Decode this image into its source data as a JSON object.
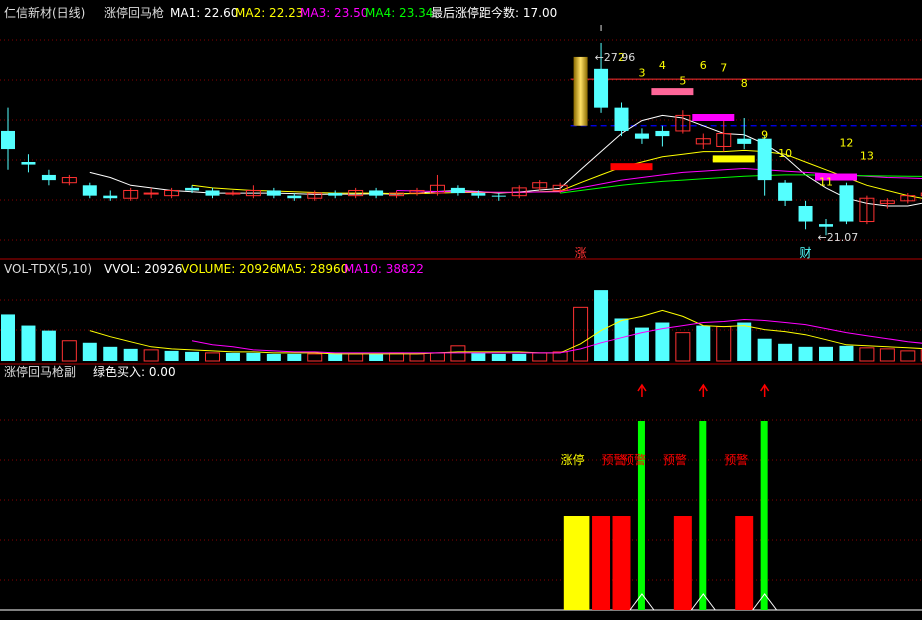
{
  "header_main": {
    "stock": "仁信新材(日线)",
    "indicator": "涨停回马枪",
    "ma1_label": "MA1: 22.60",
    "ma2_label": "MA2: 22.23",
    "ma3_label": "MA3: 23.50",
    "ma4_label": "MA4: 23.34",
    "last_limit_label": "最后涨停距今数: 17.00"
  },
  "header_vol": {
    "name": "VOL-TDX(5,10)",
    "vvol_label": "VVOL: 20926",
    "volume_label": "VOLUME: 20926",
    "ma5_label": "MA5: 28960",
    "ma10_label": "MA10: 38822"
  },
  "header_sub": {
    "name": "涨停回马枪副",
    "signal_label": "绿色买入: 0.00"
  },
  "colors": {
    "up": "#ff3232",
    "down": "#54ffff",
    "ma1": "#ffffff",
    "ma2": "#ffff00",
    "ma3": "#ff00ff",
    "ma4": "#00ff00",
    "grid": "#8b0000",
    "dash": "#0000ff",
    "vol_ma10": "#ff00ff",
    "vol_ma5": "#ffff00",
    "buy": "#00ff00",
    "warn": "#ff0000",
    "limit": "#ffff00"
  },
  "chart_data": [
    {
      "type": "candlestick",
      "panel": "price",
      "candles": [
        {
          "o": 24.4,
          "c": 25.1,
          "h": 26.0,
          "l": 23.6,
          "dir": "down"
        },
        {
          "o": 23.9,
          "c": 23.8,
          "h": 24.2,
          "l": 23.5,
          "dir": "down"
        },
        {
          "o": 23.4,
          "c": 23.2,
          "h": 23.6,
          "l": 23.0,
          "dir": "down"
        },
        {
          "o": 23.1,
          "c": 23.3,
          "h": 23.4,
          "l": 23.0,
          "dir": "up"
        },
        {
          "o": 23.0,
          "c": 22.6,
          "h": 23.1,
          "l": 22.5,
          "dir": "down"
        },
        {
          "o": 22.6,
          "c": 22.5,
          "h": 22.8,
          "l": 22.4,
          "dir": "down"
        },
        {
          "o": 22.5,
          "c": 22.8,
          "h": 22.9,
          "l": 22.4,
          "dir": "up"
        },
        {
          "o": 22.7,
          "c": 22.7,
          "h": 22.9,
          "l": 22.5,
          "dir": "up"
        },
        {
          "o": 22.6,
          "c": 22.8,
          "h": 22.9,
          "l": 22.5,
          "dir": "up"
        },
        {
          "o": 22.9,
          "c": 22.8,
          "h": 23.0,
          "l": 22.7,
          "dir": "down"
        },
        {
          "o": 22.8,
          "c": 22.6,
          "h": 22.9,
          "l": 22.5,
          "dir": "down"
        },
        {
          "o": 22.7,
          "c": 22.7,
          "h": 22.8,
          "l": 22.6,
          "dir": "up"
        },
        {
          "o": 22.6,
          "c": 22.8,
          "h": 23.0,
          "l": 22.5,
          "dir": "up"
        },
        {
          "o": 22.8,
          "c": 22.6,
          "h": 22.9,
          "l": 22.5,
          "dir": "down"
        },
        {
          "o": 22.6,
          "c": 22.5,
          "h": 22.7,
          "l": 22.4,
          "dir": "down"
        },
        {
          "o": 22.5,
          "c": 22.7,
          "h": 22.8,
          "l": 22.4,
          "dir": "up"
        },
        {
          "o": 22.7,
          "c": 22.6,
          "h": 22.8,
          "l": 22.5,
          "dir": "down"
        },
        {
          "o": 22.6,
          "c": 22.8,
          "h": 22.9,
          "l": 22.5,
          "dir": "up"
        },
        {
          "o": 22.8,
          "c": 22.6,
          "h": 22.9,
          "l": 22.5,
          "dir": "down"
        },
        {
          "o": 22.6,
          "c": 22.7,
          "h": 22.8,
          "l": 22.5,
          "dir": "up"
        },
        {
          "o": 22.7,
          "c": 22.8,
          "h": 22.9,
          "l": 22.6,
          "dir": "up"
        },
        {
          "o": 22.7,
          "c": 23.0,
          "h": 23.4,
          "l": 22.6,
          "dir": "up"
        },
        {
          "o": 22.9,
          "c": 22.7,
          "h": 23.0,
          "l": 22.6,
          "dir": "down"
        },
        {
          "o": 22.7,
          "c": 22.6,
          "h": 22.8,
          "l": 22.5,
          "dir": "down"
        },
        {
          "o": 22.6,
          "c": 22.6,
          "h": 22.7,
          "l": 22.4,
          "dir": "down"
        },
        {
          "o": 22.6,
          "c": 22.9,
          "h": 23.0,
          "l": 22.5,
          "dir": "up"
        },
        {
          "o": 22.9,
          "c": 23.1,
          "h": 23.2,
          "l": 22.8,
          "dir": "up"
        },
        {
          "o": 22.8,
          "c": 23.0,
          "h": 23.1,
          "l": 22.7,
          "dir": "up"
        },
        {
          "o": 25.3,
          "c": 27.96,
          "h": 27.96,
          "l": 25.3,
          "dir": "limit"
        },
        {
          "o": 27.5,
          "c": 26.0,
          "h": 28.5,
          "l": 25.8,
          "dir": "down"
        },
        {
          "o": 26.0,
          "c": 25.1,
          "h": 26.2,
          "l": 24.9,
          "dir": "down"
        },
        {
          "o": 25.0,
          "c": 24.8,
          "h": 25.2,
          "l": 24.6,
          "dir": "down"
        },
        {
          "o": 24.9,
          "c": 25.1,
          "h": 25.3,
          "l": 24.5,
          "dir": "down"
        },
        {
          "o": 25.1,
          "c": 25.7,
          "h": 25.9,
          "l": 25.0,
          "dir": "up"
        },
        {
          "o": 24.6,
          "c": 24.8,
          "h": 25.0,
          "l": 24.4,
          "dir": "up"
        },
        {
          "o": 24.5,
          "c": 25.0,
          "h": 25.5,
          "l": 24.3,
          "dir": "up"
        },
        {
          "o": 24.8,
          "c": 24.6,
          "h": 25.6,
          "l": 24.4,
          "dir": "down"
        },
        {
          "o": 24.8,
          "c": 23.2,
          "h": 24.9,
          "l": 22.6,
          "dir": "down"
        },
        {
          "o": 23.1,
          "c": 22.4,
          "h": 23.2,
          "l": 22.2,
          "dir": "down"
        },
        {
          "o": 22.2,
          "c": 21.6,
          "h": 22.4,
          "l": 21.3,
          "dir": "down"
        },
        {
          "o": 21.5,
          "c": 21.4,
          "h": 21.7,
          "l": 21.07,
          "dir": "down"
        },
        {
          "o": 23.0,
          "c": 21.6,
          "h": 23.1,
          "l": 21.5,
          "dir": "down"
        },
        {
          "o": 21.6,
          "c": 22.5,
          "h": 22.6,
          "l": 21.5,
          "dir": "up"
        },
        {
          "o": 22.3,
          "c": 22.4,
          "h": 22.5,
          "l": 22.1,
          "dir": "up"
        },
        {
          "o": 22.4,
          "c": 22.6,
          "h": 22.7,
          "l": 22.3,
          "dir": "up"
        },
        {
          "o": 22.6,
          "c": 22.7,
          "h": 23.0,
          "l": 22.5,
          "dir": "up"
        },
        {
          "o": 22.7,
          "c": 23.0,
          "h": 23.1,
          "l": 22.6,
          "dir": "down"
        }
      ],
      "ma_lines": [
        {
          "name": "MA1",
          "values": [
            null,
            null,
            null,
            null,
            23.5,
            23.3,
            23.0,
            22.9,
            22.8,
            22.75,
            22.7,
            22.7,
            22.7,
            22.7,
            22.68,
            22.65,
            22.66,
            22.66,
            22.67,
            22.66,
            22.7,
            22.76,
            22.8,
            22.76,
            22.7,
            22.74,
            22.82,
            22.88,
            23.6,
            24.3,
            25.0,
            25.5,
            25.7,
            25.6,
            25.3,
            25.0,
            24.95,
            24.6,
            24.1,
            23.4,
            22.9,
            22.5,
            22.3,
            22.2,
            22.2,
            22.35,
            22.55
          ]
        },
        {
          "name": "MA2",
          "values": [
            null,
            null,
            null,
            null,
            null,
            null,
            null,
            null,
            null,
            23.0,
            22.9,
            22.85,
            22.8,
            22.78,
            22.75,
            22.72,
            22.7,
            22.7,
            22.7,
            22.68,
            22.68,
            22.7,
            22.72,
            22.72,
            22.72,
            22.72,
            22.75,
            22.78,
            23.1,
            23.4,
            23.7,
            23.9,
            24.1,
            24.2,
            24.3,
            24.3,
            24.35,
            24.3,
            24.2,
            23.9,
            23.6,
            23.3,
            23.0,
            22.8,
            22.6,
            22.45,
            22.4
          ]
        },
        {
          "name": "MA3",
          "values": [
            null,
            null,
            null,
            null,
            null,
            null,
            null,
            null,
            null,
            null,
            null,
            null,
            null,
            null,
            null,
            null,
            null,
            null,
            null,
            22.8,
            22.78,
            22.76,
            22.75,
            22.74,
            22.73,
            22.73,
            22.74,
            22.75,
            22.9,
            23.05,
            23.2,
            23.3,
            23.4,
            23.5,
            23.55,
            23.6,
            23.65,
            23.6,
            23.55,
            23.5,
            23.45,
            23.4,
            23.35,
            23.3,
            23.28,
            23.25,
            23.25
          ]
        },
        {
          "name": "MA4",
          "values": [
            null,
            null,
            null,
            null,
            null,
            null,
            null,
            null,
            null,
            null,
            null,
            null,
            null,
            null,
            null,
            null,
            null,
            null,
            null,
            null,
            null,
            null,
            null,
            null,
            null,
            null,
            null,
            22.7,
            22.8,
            22.9,
            23.0,
            23.08,
            23.15,
            23.2,
            23.25,
            23.3,
            23.35,
            23.38,
            23.4,
            23.4,
            23.39,
            23.38,
            23.37,
            23.36,
            23.35,
            23.34,
            23.34
          ]
        }
      ],
      "resistance_line": 27.1,
      "dash_line": 25.3,
      "zones": [
        {
          "i": 30,
          "value": 23.7,
          "color": "#ff0000"
        },
        {
          "i": 32,
          "value": 26.6,
          "color": "#ff6699"
        },
        {
          "i": 34,
          "value": 25.6,
          "color": "#ff00ff"
        },
        {
          "i": 35,
          "value": 24.0,
          "color": "#ffff00"
        },
        {
          "i": 40,
          "value": 23.3,
          "color": "#ff00ff"
        }
      ],
      "counters": [
        {
          "i": 30,
          "text": "2",
          "value": 27.8
        },
        {
          "i": 31,
          "text": "3",
          "value": 27.2
        },
        {
          "i": 32,
          "text": "4",
          "value": 27.5
        },
        {
          "i": 33,
          "text": "5",
          "value": 26.9
        },
        {
          "i": 34,
          "text": "6",
          "value": 27.5
        },
        {
          "i": 35,
          "text": "7",
          "value": 27.4
        },
        {
          "i": 36,
          "text": "8",
          "value": 26.8
        },
        {
          "i": 37,
          "text": "9",
          "value": 24.8
        },
        {
          "i": 38,
          "text": "10",
          "value": 24.1
        },
        {
          "i": 40,
          "text": "11",
          "value": 23.0
        },
        {
          "i": 41,
          "text": "12",
          "value": 24.5
        },
        {
          "i": 42,
          "text": "13",
          "value": 24.0
        }
      ],
      "max_label": "27.96",
      "min_label": "21.07",
      "markers": [
        {
          "i": 28,
          "text": "涨",
          "color": "#ff3232"
        },
        {
          "i": 39,
          "text": "财",
          "color": "#54ffff"
        }
      ]
    },
    {
      "type": "bar",
      "panel": "volume",
      "values": [
        46,
        35,
        30,
        20,
        18,
        14,
        12,
        11,
        10,
        9,
        8,
        8,
        8,
        7,
        7,
        7,
        8,
        7,
        7,
        8,
        7,
        8,
        15,
        8,
        7,
        7,
        8,
        9,
        53,
        70,
        42,
        33,
        38,
        28,
        35,
        34,
        38,
        22,
        17,
        14,
        14,
        15,
        13,
        12,
        10,
        11,
        9
      ],
      "dirs": [
        "d",
        "d",
        "d",
        "u",
        "d",
        "d",
        "d",
        "u",
        "d",
        "d",
        "u",
        "d",
        "d",
        "d",
        "d",
        "u",
        "d",
        "u",
        "d",
        "u",
        "u",
        "u",
        "u",
        "d",
        "d",
        "d",
        "u",
        "u",
        "l",
        "d",
        "d",
        "d",
        "d",
        "u",
        "d",
        "u",
        "d",
        "d",
        "d",
        "d",
        "d",
        "d",
        "u",
        "u",
        "u",
        "u",
        "u"
      ],
      "ma5": [
        null,
        null,
        null,
        null,
        30,
        24,
        19,
        14,
        12,
        11,
        10,
        9,
        9,
        8,
        8,
        8,
        7,
        7,
        7,
        7,
        7,
        8,
        9,
        9,
        9,
        9,
        8,
        8,
        17,
        30,
        40,
        44,
        50,
        44,
        35,
        34,
        35,
        31,
        29,
        26,
        21,
        16,
        15,
        14,
        13,
        12,
        11
      ],
      "ma10": [
        null,
        null,
        null,
        null,
        null,
        null,
        null,
        null,
        null,
        20,
        16,
        14,
        11,
        10,
        9,
        9,
        8,
        8,
        8,
        8,
        8,
        8,
        8,
        8,
        8,
        8,
        8,
        8,
        12,
        18,
        23,
        28,
        32,
        35,
        38,
        39,
        41,
        40,
        38,
        36,
        32,
        28,
        25,
        22,
        19,
        17,
        15
      ],
      "max": 80
    },
    {
      "type": "signal",
      "panel": "sub",
      "bars": [
        {
          "i": 28,
          "w": 1.4,
          "value": 1.0,
          "color": "#ffff00"
        },
        {
          "i": 29,
          "value": 1.0,
          "color": "#ff0000"
        },
        {
          "i": 30,
          "value": 1.0,
          "color": "#ff0000"
        },
        {
          "i": 33,
          "value": 1.0,
          "color": "#ff0000"
        },
        {
          "i": 36,
          "value": 1.0,
          "color": "#ff0000"
        }
      ],
      "buy_signals": [
        31,
        34,
        37
      ],
      "labels": [
        {
          "i": 28,
          "text": "涨停",
          "color": "#ffff00"
        },
        {
          "i": 30,
          "text": "预警",
          "color": "#ff0000"
        },
        {
          "i": 31,
          "text": "预警",
          "color": "#ff0000"
        },
        {
          "i": 33,
          "text": "预警",
          "color": "#ff0000"
        },
        {
          "i": 36,
          "text": "预警",
          "color": "#ff0000"
        }
      ]
    }
  ]
}
